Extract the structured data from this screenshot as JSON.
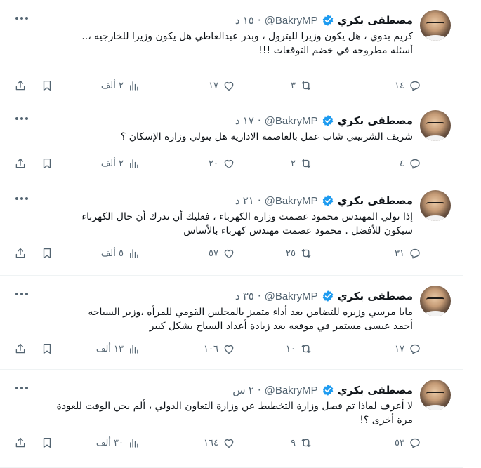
{
  "tweets": [
    {
      "name": "مصطفى بكري",
      "handle": "@BakryMP",
      "time": "١٥ د",
      "lines": [
        "كريم بدوي ، هل يكون وزيرا للبترول ، وبدر عبدالعاطي هل يكون وزيرا للخارجيه ،..",
        "أسئله مطروحه في خضم التوقعات !!!"
      ],
      "replies": "١٤",
      "retweets": "٣",
      "likes": "١٧",
      "views": "٢ ألف"
    },
    {
      "name": "مصطفى بكري",
      "handle": "@BakryMP",
      "time": "١٧ د",
      "lines": [
        "شريف الشربيني شاب عمل بالعاصمه الاداريه هل يتولي وزارة الإسكان ؟"
      ],
      "replies": "٤",
      "retweets": "٢",
      "likes": "٢٠",
      "views": "٢ ألف"
    },
    {
      "name": "مصطفى بكري",
      "handle": "@BakryMP",
      "time": "٢١ د",
      "lines": [
        "إذا تولي المهندس محمود عصمت وزارة الكهرباء ، فعليك أن تدرك أن حال الكهرباء",
        "سيكون للأفضل . محمود عصمت مهندس كهرباء بالأساس"
      ],
      "replies": "٣١",
      "retweets": "٢٥",
      "likes": "٥٧",
      "views": "٥ ألف"
    },
    {
      "name": "مصطفى بكري",
      "handle": "@BakryMP",
      "time": "٣٥ د",
      "lines": [
        "مايا  مرسي وزيره للتضامن بعد أداء متميز بالمجلس القومي للمرأه ،وزير السياحه",
        "أحمد عيسى مستمر في موقعه بعد زيادة أعداد السياح بشكل كبير"
      ],
      "replies": "١٧",
      "retweets": "١٠",
      "likes": "١٠٦",
      "views": "١٣ ألف"
    },
    {
      "name": "مصطفى بكري",
      "handle": "@BakryMP",
      "time": "٢ س",
      "lines": [
        "لا أعرف لماذا تم فصل وزارة التخطيط عن وزارة التعاون الدولي ، ألم يحن الوقت للعودة",
        "مرة أخرى ؟!"
      ],
      "replies": "٥٣",
      "retweets": "٩",
      "likes": "١٦٤",
      "views": "٣٠ ألف"
    }
  ],
  "colors": {
    "text": "#0f1419",
    "secondary": "#536471",
    "verified": "#1d9bf0",
    "divider": "#eff3f4"
  },
  "icons": {
    "reply": "reply-icon",
    "retweet": "retweet-icon",
    "like": "heart-icon",
    "views": "analytics-icon",
    "bookmark": "bookmark-icon",
    "share": "share-icon",
    "more": "more-icon",
    "verified": "verified-badge-icon"
  }
}
